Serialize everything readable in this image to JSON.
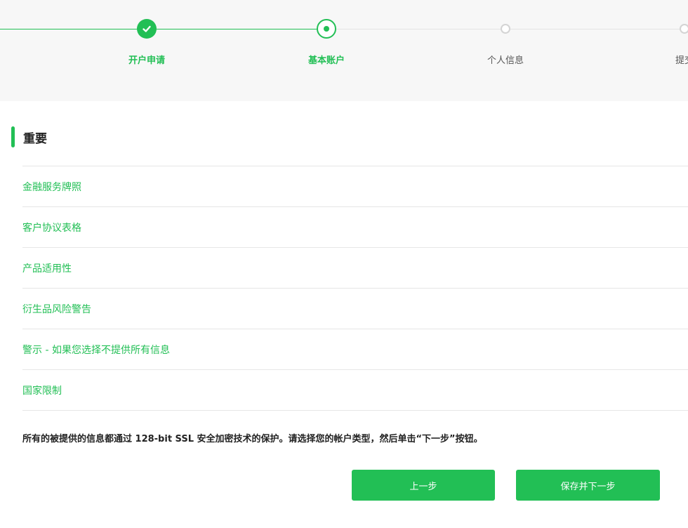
{
  "stepper": {
    "steps": [
      {
        "label": "开户申请",
        "state": "done"
      },
      {
        "label": "基本账户",
        "state": "active"
      },
      {
        "label": "个人信息",
        "state": "todo"
      },
      {
        "label": "提交",
        "state": "todo"
      }
    ],
    "accent_color": "#22bf55"
  },
  "section": {
    "title": "重要"
  },
  "links": [
    {
      "label": "金融服务牌照"
    },
    {
      "label": "客户协议表格"
    },
    {
      "label": "产品适用性"
    },
    {
      "label": "衍生品风险警告"
    },
    {
      "label": "警示 - 如果您选择不提供所有信息"
    },
    {
      "label": "国家限制"
    }
  ],
  "notice": "所有的被提供的信息都通过 128-bit SSL 安全加密技术的保护。请选择您的帐户类型，然后单击“下一步”按钮。",
  "buttons": {
    "prev_label": "上一步",
    "next_label": "保存并下一步"
  }
}
